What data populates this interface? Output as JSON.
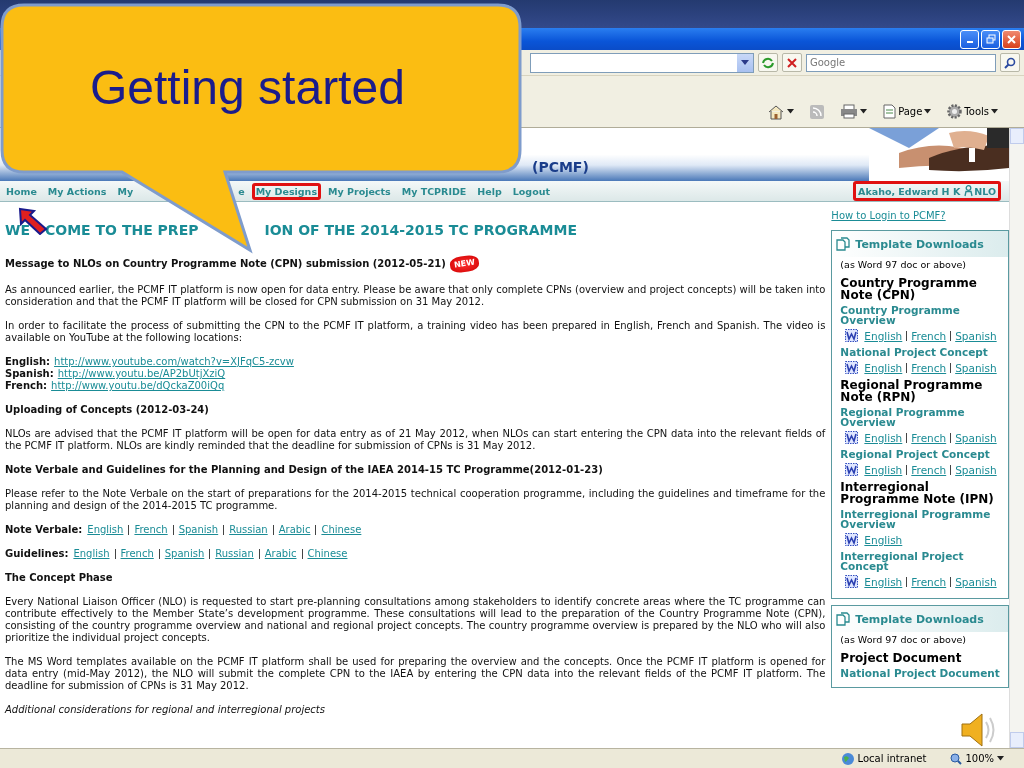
{
  "callout": {
    "text": "Getting started"
  },
  "browser": {
    "search": {
      "placeholder": "Google"
    },
    "commands": [
      {
        "kind": "home"
      },
      {
        "kind": "feeds"
      },
      {
        "kind": "print"
      },
      {
        "kind": "page",
        "label": "Page"
      },
      {
        "kind": "tools",
        "label": "Tools"
      }
    ]
  },
  "banner": {
    "title": "(PCMF)"
  },
  "nav": {
    "items": [
      {
        "label": "Home",
        "highlighted": false
      },
      {
        "label": "My Actions",
        "highlighted": false
      },
      {
        "label": "My",
        "highlighted": false
      },
      {
        "label": "e",
        "highlighted": false
      },
      {
        "label": "My Designs",
        "highlighted": true
      },
      {
        "label": "My Projects",
        "highlighted": false
      },
      {
        "label": "My TCPRIDE",
        "highlighted": false
      },
      {
        "label": "Help",
        "highlighted": false
      },
      {
        "label": "Logout",
        "highlighted": false
      }
    ],
    "user": {
      "name": "Akaho, Edward H K",
      "role": "NLO",
      "highlighted": true
    }
  },
  "heading_fragments": [
    "WE",
    "COME TO THE PREP",
    "ION OF THE 2014-2015 TC PROGRAMME"
  ],
  "sections": [
    {
      "kind": "heading",
      "text": "Message to NLOs on Country Programme Note (CPN) submission (2012-05-21)",
      "badge": "NEW"
    },
    {
      "kind": "paragraph",
      "text": "As announced earlier, the PCMF IT platform is now open for data entry. Please be aware that only complete CPNs (overview and project concepts) will be taken into consideration and that the PCMF IT platform will be closed for CPN submission on 31 May 2012."
    },
    {
      "kind": "paragraph",
      "text": "In order to facilitate the process of submitting the CPN to the PCMF IT platform, a training video has been prepared in English, French and Spanish. The video is available on YouTube at the following locations:"
    },
    {
      "kind": "urls",
      "rows": [
        {
          "label": "English:",
          "url": "http://www.youtube.com/watch?v=XJFqC5-zcvw"
        },
        {
          "label": "Spanish:",
          "url": "http://www.youtu.be/AP2bUtjXziQ"
        },
        {
          "label": "French:",
          "url": "http://www.youtu.be/dQckaZ00iQq"
        }
      ]
    },
    {
      "kind": "heading",
      "text": "Uploading of Concepts (2012-03-24)"
    },
    {
      "kind": "paragraph",
      "text": "NLOs are advised that the PCMF IT platform will be open for data entry as of 21 May 2012, when NLOs can start entering the CPN data into the relevant fields of the PCMF IT platform. NLOs are kindly reminded that the deadline for submission of CPNs is 31 May 2012."
    },
    {
      "kind": "heading",
      "text": "Note Verbale and Guidelines for the Planning and Design of the IAEA 2014-15 TC Programme(2012-01-23)"
    },
    {
      "kind": "paragraph",
      "text": "Please refer to the Note Verbale on the start of preparations for the 2014-2015 technical cooperation programme, including the guidelines and timeframe for the planning and design of the 2014-2015 TC programme."
    },
    {
      "kind": "langs",
      "label": "Note Verbale:",
      "links": [
        "English",
        "French",
        "Spanish",
        "Russian",
        "Arabic",
        "Chinese"
      ]
    },
    {
      "kind": "langs",
      "label": "Guidelines:",
      "links": [
        "English",
        "French",
        "Spanish",
        "Russian",
        "Arabic",
        "Chinese"
      ]
    },
    {
      "kind": "heading",
      "text": "The Concept Phase"
    },
    {
      "kind": "paragraph",
      "text": "Every National Liaison Officer (NLO) is requested to start pre-planning consultations among stakeholders to identify concrete areas where the TC programme can contribute effectively to the Member State’s development programme. These consultations will lead to the preparation of the Country Programme Note (CPN), consisting of the country programme overview and national and regional project concepts. The country programme overview is prepared by the NLO who will also prioritize the individual project concepts."
    },
    {
      "kind": "paragraph",
      "text": "The MS Word templates available on the PCMF IT platform shall be used for preparing the overview and the concepts. Once the PCMF IT platform is opened for data entry (mid-May 2012), the NLO will submit the complete CPN to the IAEA by entering the CPN data into the relevant fields of the PCMF IT platform. The deadline for submission of CPNs is 31 May 2012."
    },
    {
      "kind": "italic",
      "text": "Additional considerations for regional and interregional projects"
    }
  ],
  "sidebar": {
    "login_link": "How to Login to PCMF?",
    "panels": [
      {
        "title": "Template Downloads",
        "note": "(as Word 97 doc or above)",
        "items": [
          {
            "kind": "group",
            "text": "Country Programme Note (CPN)"
          },
          {
            "kind": "subhead",
            "text": "Country Programme Overview"
          },
          {
            "kind": "links",
            "links": [
              "English",
              "French",
              "Spanish"
            ]
          },
          {
            "kind": "subhead",
            "text": "National Project Concept"
          },
          {
            "kind": "links",
            "links": [
              "English",
              "French",
              "Spanish"
            ]
          },
          {
            "kind": "group",
            "text": "Regional Programme Note (RPN)"
          },
          {
            "kind": "subhead",
            "text": "Regional Programme Overview"
          },
          {
            "kind": "links",
            "links": [
              "English",
              "French",
              "Spanish"
            ]
          },
          {
            "kind": "subhead",
            "text": "Regional Project Concept"
          },
          {
            "kind": "links",
            "links": [
              "English",
              "French",
              "Spanish"
            ]
          },
          {
            "kind": "group",
            "text": "Interregional Programme Note (IPN)"
          },
          {
            "kind": "subhead",
            "text": "Interregional Programme Overview"
          },
          {
            "kind": "links",
            "links": [
              "English"
            ]
          },
          {
            "kind": "subhead",
            "text": "Interregional Project Concept"
          },
          {
            "kind": "links",
            "links": [
              "English",
              "French",
              "Spanish"
            ]
          }
        ]
      },
      {
        "title": "Template Downloads",
        "note": "(as Word 97 doc or above)",
        "items": [
          {
            "kind": "group",
            "text": "Project Document"
          },
          {
            "kind": "subhead",
            "text": "National Project Document"
          }
        ]
      }
    ]
  },
  "status_bar": {
    "zone": "Local intranet",
    "zoom": "100%"
  }
}
